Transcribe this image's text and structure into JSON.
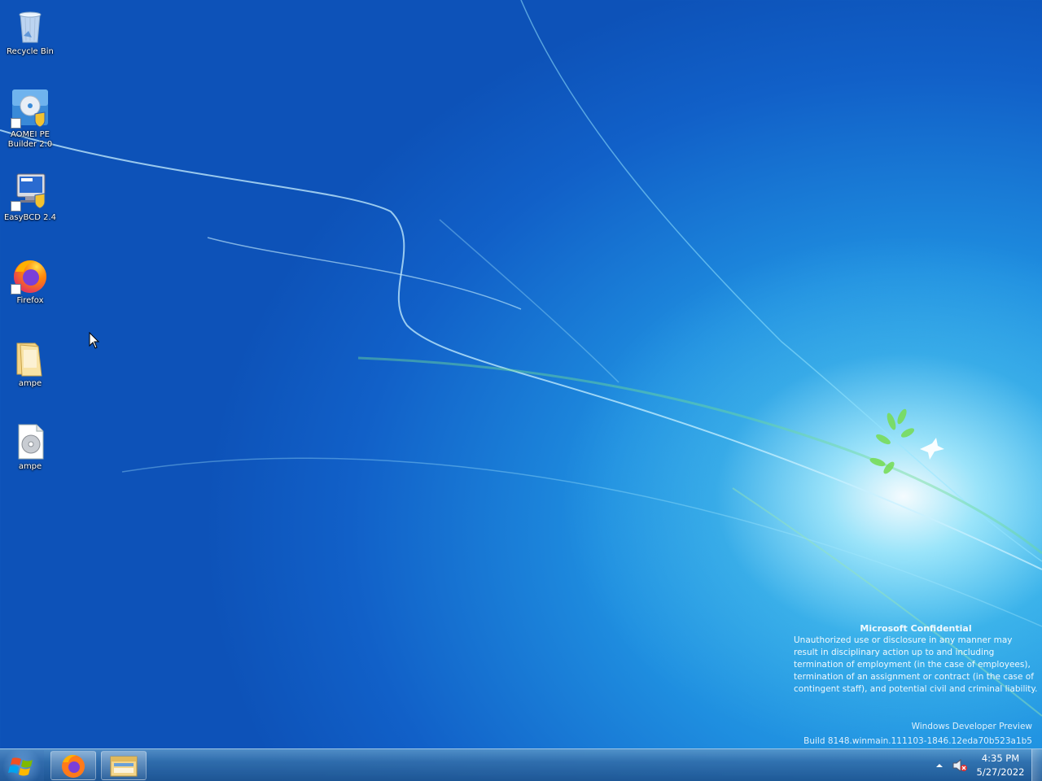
{
  "desktop": {
    "icons": [
      {
        "label": "Recycle Bin",
        "icon": "recycle-bin-icon"
      },
      {
        "label": "AOMEI PE Builder 2.0",
        "icon": "aomei-pe-builder-icon"
      },
      {
        "label": "EasyBCD 2.4",
        "icon": "easybcd-icon"
      },
      {
        "label": "Firefox",
        "icon": "firefox-icon"
      },
      {
        "label": "ampe",
        "icon": "folder-icon"
      },
      {
        "label": "ampe",
        "icon": "disc-image-file-icon"
      }
    ]
  },
  "watermark": {
    "title": "Microsoft Confidential",
    "body": "Unauthorized use or disclosure in any manner may result in disciplinary action up to and including termination of employment (in the case of employees), termination of an assignment or contract (in the case of contingent staff), and potential civil and criminal liability."
  },
  "build": {
    "edition": "Windows Developer Preview",
    "build_string": "Build 8148.winmain.111103-1846.12eda70b523a1b5"
  },
  "taskbar": {
    "start_icon": "windows-logo-icon",
    "pinned": [
      {
        "name": "Firefox",
        "icon": "firefox-icon"
      },
      {
        "name": "File Explorer",
        "icon": "file-explorer-icon"
      }
    ],
    "tray": {
      "chevron_icon": "chevron-up-icon",
      "volume_icon": "volume-muted-icon",
      "time": "4:35 PM",
      "date": "5/27/2022"
    }
  },
  "colors": {
    "desktop_blue": "#1160c8",
    "glow": "#bef5ff",
    "taskbar": "#326eaa"
  }
}
